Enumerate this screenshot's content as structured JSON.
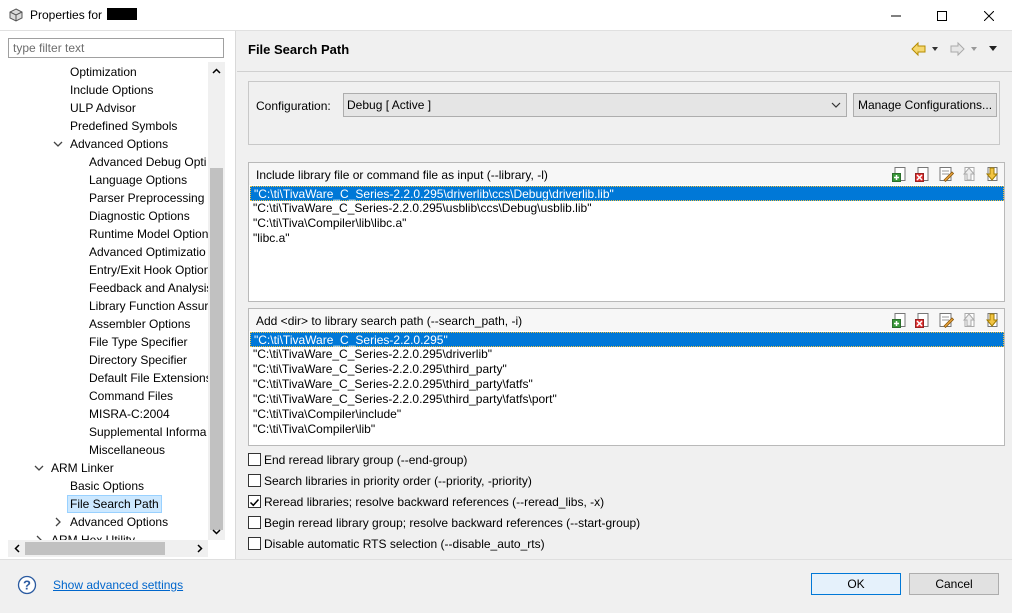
{
  "window": {
    "title": "Properties for",
    "minimize_icon": "minimize-icon",
    "maximize_icon": "maximize-icon",
    "close_icon": "close-icon"
  },
  "left": {
    "filter_placeholder": "type filter text",
    "tree": [
      {
        "label": "Optimization",
        "level": 2
      },
      {
        "label": "Include Options",
        "level": 2
      },
      {
        "label": "ULP Advisor",
        "level": 2
      },
      {
        "label": "Predefined Symbols",
        "level": 2
      },
      {
        "label": "Advanced Options",
        "level": 2,
        "twisty": "expanded"
      },
      {
        "label": "Advanced Debug Opti",
        "level": 3
      },
      {
        "label": "Language Options",
        "level": 3
      },
      {
        "label": "Parser Preprocessing C",
        "level": 3
      },
      {
        "label": "Diagnostic Options",
        "level": 3
      },
      {
        "label": "Runtime Model Option",
        "level": 3
      },
      {
        "label": "Advanced Optimizatio",
        "level": 3
      },
      {
        "label": "Entry/Exit Hook Option",
        "level": 3
      },
      {
        "label": "Feedback and Analysis",
        "level": 3
      },
      {
        "label": "Library Function Assur",
        "level": 3
      },
      {
        "label": "Assembler Options",
        "level": 3
      },
      {
        "label": "File Type Specifier",
        "level": 3
      },
      {
        "label": "Directory Specifier",
        "level": 3
      },
      {
        "label": "Default File Extensions",
        "level": 3
      },
      {
        "label": "Command Files",
        "level": 3
      },
      {
        "label": "MISRA-C:2004",
        "level": 3
      },
      {
        "label": "Supplemental Informa",
        "level": 3
      },
      {
        "label": "Miscellaneous",
        "level": 3
      },
      {
        "label": "ARM Linker",
        "level": 1,
        "twisty": "expanded"
      },
      {
        "label": "Basic Options",
        "level": 2
      },
      {
        "label": "File Search Path",
        "level": 2,
        "selected": true
      },
      {
        "label": "Advanced Options",
        "level": 2,
        "twisty": "collapsed"
      },
      {
        "label": "ARM Hex Utility",
        "level": 1,
        "twisty": "collapsed"
      }
    ]
  },
  "main": {
    "page_title": "File Search Path",
    "config_label": "Configuration:",
    "config_value": "Debug  [ Active ]",
    "manage_button": "Manage Configurations...",
    "include_panel": {
      "label": "Include library file or command file as input (--library, -l)",
      "items": [
        "\"C:\\ti\\TivaWare_C_Series-2.2.0.295\\driverlib\\ccs\\Debug\\driverlib.lib\"",
        "\"C:\\ti\\TivaWare_C_Series-2.2.0.295\\usblib\\ccs\\Debug\\usblib.lib\"",
        "\"C:\\ti\\Tiva\\Compiler\\lib\\libc.a\"",
        "\"libc.a\""
      ],
      "selected_index": 0
    },
    "search_panel": {
      "label": "Add <dir> to library search path (--search_path, -i)",
      "items": [
        "\"C:\\ti\\TivaWare_C_Series-2.2.0.295\"",
        "\"C:\\ti\\TivaWare_C_Series-2.2.0.295\\driverlib\"",
        "\"C:\\ti\\TivaWare_C_Series-2.2.0.295\\third_party\"",
        "\"C:\\ti\\TivaWare_C_Series-2.2.0.295\\third_party\\fatfs\"",
        "\"C:\\ti\\TivaWare_C_Series-2.2.0.295\\third_party\\fatfs\\port\"",
        "\"C:\\ti\\Tiva\\Compiler\\include\"",
        "\"C:\\ti\\Tiva\\Compiler\\lib\""
      ],
      "selected_index": 0
    },
    "tool_icons": [
      "add-icon",
      "delete-icon",
      "edit-icon",
      "move-up-icon",
      "move-down-icon"
    ],
    "checkboxes": [
      {
        "label": "End reread library group (--end-group)",
        "checked": false
      },
      {
        "label": "Search libraries in priority order (--priority, -priority)",
        "checked": false
      },
      {
        "label": "Reread libraries; resolve backward references (--reread_libs, -x)",
        "checked": true
      },
      {
        "label": "Begin reread library group; resolve backward references (--start-group)",
        "checked": false
      },
      {
        "label": "Disable automatic RTS selection (--disable_auto_rts)",
        "checked": false
      }
    ]
  },
  "footer": {
    "help_icon": "help-icon",
    "advanced_link": "Show advanced settings",
    "ok_label": "OK",
    "cancel_label": "Cancel"
  },
  "colors": {
    "selection": "#0078d7",
    "link": "#0066cc",
    "tree_selection": "#cce8ff"
  }
}
